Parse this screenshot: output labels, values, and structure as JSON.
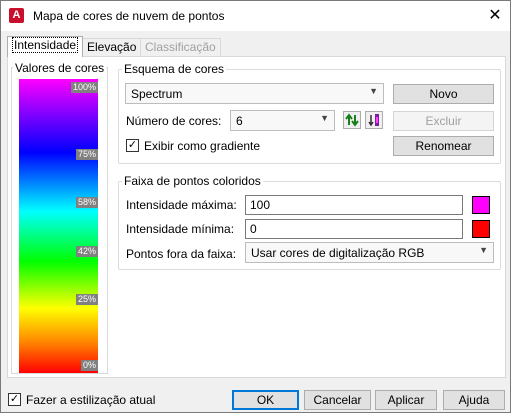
{
  "window": {
    "title": "Mapa de cores de nuvem de pontos",
    "app_icon": "A"
  },
  "tabs": [
    {
      "label": "Intensidade",
      "active": true
    },
    {
      "label": "Elevação",
      "active": false
    },
    {
      "label": "Classificação",
      "active": false,
      "disabled": true
    }
  ],
  "colorbar": {
    "title": "Valores de cores",
    "ticks": [
      "100%",
      "75%",
      "58%",
      "42%",
      "25%",
      "0%"
    ]
  },
  "scheme": {
    "group_title": "Esquema de cores",
    "selected": "Spectrum",
    "num_colors_label": "Número de cores:",
    "num_colors_value": "6",
    "gradient_label": "Exibir como gradiente",
    "gradient_checked": true,
    "new_button": "Novo",
    "delete_button": "Excluir",
    "rename_button": "Renomear"
  },
  "range": {
    "group_title": "Faixa de pontos coloridos",
    "max_label": "Intensidade máxima:",
    "max_value": "100",
    "max_color": "#ff00ff",
    "min_label": "Intensidade mínima:",
    "min_value": "0",
    "min_color": "#ff0000",
    "outside_label": "Pontos fora da faixa:",
    "outside_value": "Usar cores de digitalização RGB"
  },
  "footer": {
    "current_style_label": "Fazer a estilização atual",
    "current_style_checked": true,
    "ok": "OK",
    "cancel": "Cancelar",
    "apply": "Aplicar",
    "help": "Ajuda"
  }
}
